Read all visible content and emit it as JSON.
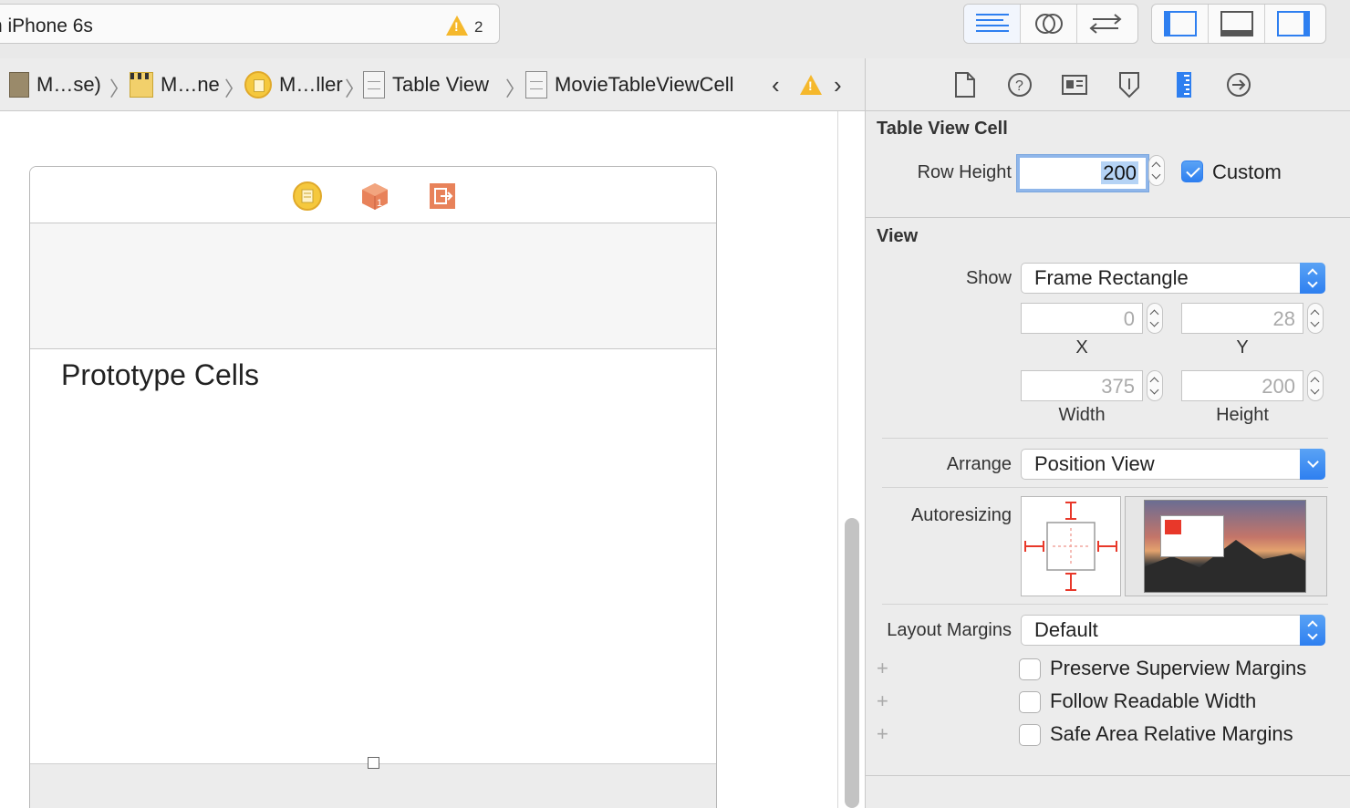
{
  "toolbar": {
    "scheme": "n iPhone 6s",
    "warning_count": "2"
  },
  "breadcrumb": {
    "items": [
      {
        "label": "M…se)"
      },
      {
        "label": "M…ne"
      },
      {
        "label": "M…ller"
      },
      {
        "label": "Table View"
      },
      {
        "label": "MovieTableViewCell"
      }
    ]
  },
  "canvas": {
    "section_title": "Prototype Cells"
  },
  "inspector": {
    "table_view_cell": {
      "header": "Table View Cell",
      "row_height_label": "Row Height",
      "row_height_value": "200",
      "custom_label": "Custom",
      "custom_checked": true
    },
    "view": {
      "header": "View",
      "show_label": "Show",
      "show_value": "Frame Rectangle",
      "x_value": "0",
      "x_label": "X",
      "y_value": "28",
      "y_label": "Y",
      "width_value": "375",
      "width_label": "Width",
      "height_value": "200",
      "height_label": "Height",
      "arrange_label": "Arrange",
      "arrange_value": "Position View",
      "autoresizing_label": "Autoresizing",
      "layout_margins_label": "Layout Margins",
      "layout_margins_value": "Default",
      "options": [
        {
          "label": "Preserve Superview Margins",
          "checked": false
        },
        {
          "label": "Follow Readable Width",
          "checked": false
        },
        {
          "label": "Safe Area Relative Margins",
          "checked": false
        }
      ]
    }
  },
  "colors": {
    "accent": "#2e7ff0",
    "warning": "#f5b82c",
    "autoresizing_red": "#e8382a"
  }
}
